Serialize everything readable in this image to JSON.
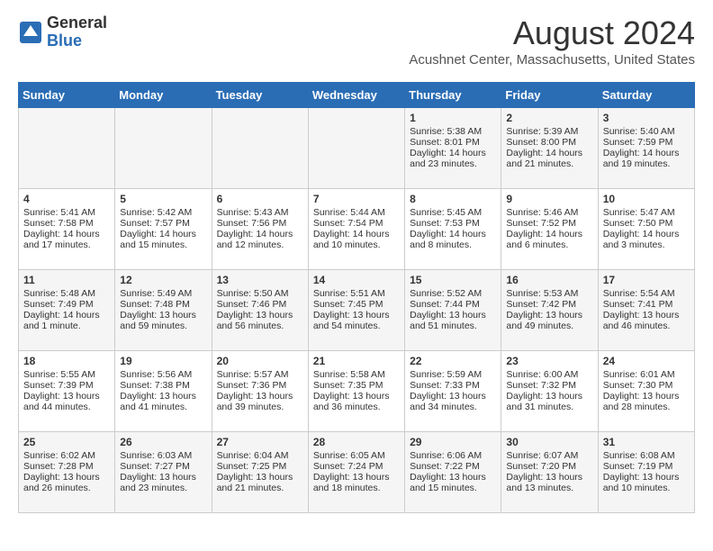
{
  "logo": {
    "general": "General",
    "blue": "Blue"
  },
  "header": {
    "month": "August 2024",
    "location": "Acushnet Center, Massachusetts, United States"
  },
  "weekdays": [
    "Sunday",
    "Monday",
    "Tuesday",
    "Wednesday",
    "Thursday",
    "Friday",
    "Saturday"
  ],
  "weeks": [
    [
      {
        "day": "",
        "sunrise": "",
        "sunset": "",
        "daylight": ""
      },
      {
        "day": "",
        "sunrise": "",
        "sunset": "",
        "daylight": ""
      },
      {
        "day": "",
        "sunrise": "",
        "sunset": "",
        "daylight": ""
      },
      {
        "day": "",
        "sunrise": "",
        "sunset": "",
        "daylight": ""
      },
      {
        "day": "1",
        "sunrise": "Sunrise: 5:38 AM",
        "sunset": "Sunset: 8:01 PM",
        "daylight": "Daylight: 14 hours and 23 minutes."
      },
      {
        "day": "2",
        "sunrise": "Sunrise: 5:39 AM",
        "sunset": "Sunset: 8:00 PM",
        "daylight": "Daylight: 14 hours and 21 minutes."
      },
      {
        "day": "3",
        "sunrise": "Sunrise: 5:40 AM",
        "sunset": "Sunset: 7:59 PM",
        "daylight": "Daylight: 14 hours and 19 minutes."
      }
    ],
    [
      {
        "day": "4",
        "sunrise": "Sunrise: 5:41 AM",
        "sunset": "Sunset: 7:58 PM",
        "daylight": "Daylight: 14 hours and 17 minutes."
      },
      {
        "day": "5",
        "sunrise": "Sunrise: 5:42 AM",
        "sunset": "Sunset: 7:57 PM",
        "daylight": "Daylight: 14 hours and 15 minutes."
      },
      {
        "day": "6",
        "sunrise": "Sunrise: 5:43 AM",
        "sunset": "Sunset: 7:56 PM",
        "daylight": "Daylight: 14 hours and 12 minutes."
      },
      {
        "day": "7",
        "sunrise": "Sunrise: 5:44 AM",
        "sunset": "Sunset: 7:54 PM",
        "daylight": "Daylight: 14 hours and 10 minutes."
      },
      {
        "day": "8",
        "sunrise": "Sunrise: 5:45 AM",
        "sunset": "Sunset: 7:53 PM",
        "daylight": "Daylight: 14 hours and 8 minutes."
      },
      {
        "day": "9",
        "sunrise": "Sunrise: 5:46 AM",
        "sunset": "Sunset: 7:52 PM",
        "daylight": "Daylight: 14 hours and 6 minutes."
      },
      {
        "day": "10",
        "sunrise": "Sunrise: 5:47 AM",
        "sunset": "Sunset: 7:50 PM",
        "daylight": "Daylight: 14 hours and 3 minutes."
      }
    ],
    [
      {
        "day": "11",
        "sunrise": "Sunrise: 5:48 AM",
        "sunset": "Sunset: 7:49 PM",
        "daylight": "Daylight: 14 hours and 1 minute."
      },
      {
        "day": "12",
        "sunrise": "Sunrise: 5:49 AM",
        "sunset": "Sunset: 7:48 PM",
        "daylight": "Daylight: 13 hours and 59 minutes."
      },
      {
        "day": "13",
        "sunrise": "Sunrise: 5:50 AM",
        "sunset": "Sunset: 7:46 PM",
        "daylight": "Daylight: 13 hours and 56 minutes."
      },
      {
        "day": "14",
        "sunrise": "Sunrise: 5:51 AM",
        "sunset": "Sunset: 7:45 PM",
        "daylight": "Daylight: 13 hours and 54 minutes."
      },
      {
        "day": "15",
        "sunrise": "Sunrise: 5:52 AM",
        "sunset": "Sunset: 7:44 PM",
        "daylight": "Daylight: 13 hours and 51 minutes."
      },
      {
        "day": "16",
        "sunrise": "Sunrise: 5:53 AM",
        "sunset": "Sunset: 7:42 PM",
        "daylight": "Daylight: 13 hours and 49 minutes."
      },
      {
        "day": "17",
        "sunrise": "Sunrise: 5:54 AM",
        "sunset": "Sunset: 7:41 PM",
        "daylight": "Daylight: 13 hours and 46 minutes."
      }
    ],
    [
      {
        "day": "18",
        "sunrise": "Sunrise: 5:55 AM",
        "sunset": "Sunset: 7:39 PM",
        "daylight": "Daylight: 13 hours and 44 minutes."
      },
      {
        "day": "19",
        "sunrise": "Sunrise: 5:56 AM",
        "sunset": "Sunset: 7:38 PM",
        "daylight": "Daylight: 13 hours and 41 minutes."
      },
      {
        "day": "20",
        "sunrise": "Sunrise: 5:57 AM",
        "sunset": "Sunset: 7:36 PM",
        "daylight": "Daylight: 13 hours and 39 minutes."
      },
      {
        "day": "21",
        "sunrise": "Sunrise: 5:58 AM",
        "sunset": "Sunset: 7:35 PM",
        "daylight": "Daylight: 13 hours and 36 minutes."
      },
      {
        "day": "22",
        "sunrise": "Sunrise: 5:59 AM",
        "sunset": "Sunset: 7:33 PM",
        "daylight": "Daylight: 13 hours and 34 minutes."
      },
      {
        "day": "23",
        "sunrise": "Sunrise: 6:00 AM",
        "sunset": "Sunset: 7:32 PM",
        "daylight": "Daylight: 13 hours and 31 minutes."
      },
      {
        "day": "24",
        "sunrise": "Sunrise: 6:01 AM",
        "sunset": "Sunset: 7:30 PM",
        "daylight": "Daylight: 13 hours and 28 minutes."
      }
    ],
    [
      {
        "day": "25",
        "sunrise": "Sunrise: 6:02 AM",
        "sunset": "Sunset: 7:28 PM",
        "daylight": "Daylight: 13 hours and 26 minutes."
      },
      {
        "day": "26",
        "sunrise": "Sunrise: 6:03 AM",
        "sunset": "Sunset: 7:27 PM",
        "daylight": "Daylight: 13 hours and 23 minutes."
      },
      {
        "day": "27",
        "sunrise": "Sunrise: 6:04 AM",
        "sunset": "Sunset: 7:25 PM",
        "daylight": "Daylight: 13 hours and 21 minutes."
      },
      {
        "day": "28",
        "sunrise": "Sunrise: 6:05 AM",
        "sunset": "Sunset: 7:24 PM",
        "daylight": "Daylight: 13 hours and 18 minutes."
      },
      {
        "day": "29",
        "sunrise": "Sunrise: 6:06 AM",
        "sunset": "Sunset: 7:22 PM",
        "daylight": "Daylight: 13 hours and 15 minutes."
      },
      {
        "day": "30",
        "sunrise": "Sunrise: 6:07 AM",
        "sunset": "Sunset: 7:20 PM",
        "daylight": "Daylight: 13 hours and 13 minutes."
      },
      {
        "day": "31",
        "sunrise": "Sunrise: 6:08 AM",
        "sunset": "Sunset: 7:19 PM",
        "daylight": "Daylight: 13 hours and 10 minutes."
      }
    ]
  ]
}
